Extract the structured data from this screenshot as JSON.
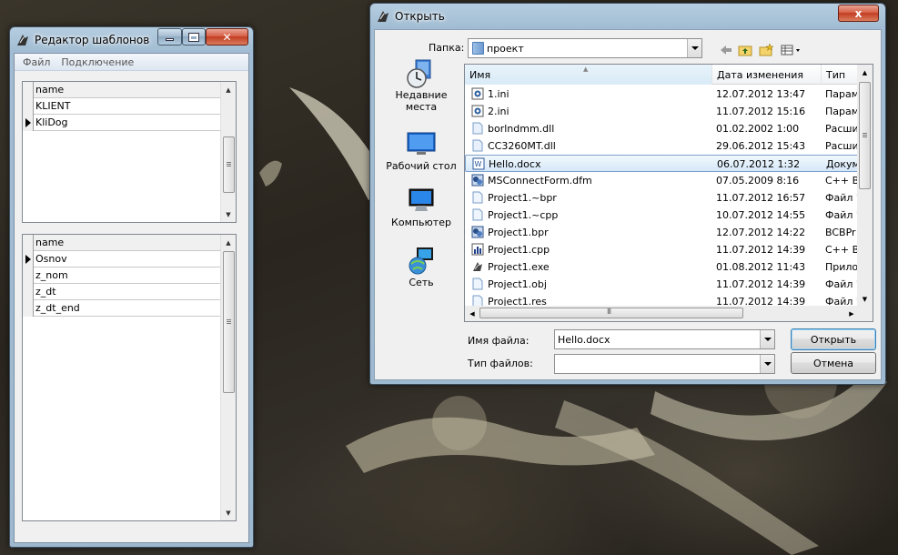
{
  "left_window": {
    "title": "Редактор шаблонов",
    "menu": [
      "Файл",
      "Подключение"
    ],
    "grid1": {
      "header": "name",
      "rows": [
        "KLIENT",
        "KliDog"
      ],
      "current_row": 1
    },
    "grid2": {
      "header": "name",
      "rows": [
        "Osnov",
        "z_nom",
        "z_dt",
        "z_dt_end"
      ],
      "current_row": 0
    }
  },
  "open_dialog": {
    "title": "Открыть",
    "folder_label": "Папка:",
    "folder_value": "проект",
    "places": [
      {
        "label": "Недавние места",
        "icon": "recent-places-icon"
      },
      {
        "label": "Рабочий стол",
        "icon": "desktop-icon"
      },
      {
        "label": "Компьютер",
        "icon": "computer-icon"
      },
      {
        "label": "Сеть",
        "icon": "network-icon"
      }
    ],
    "columns": [
      "Имя",
      "Дата изменения",
      "Тип"
    ],
    "files": [
      {
        "name": "1.ini",
        "date": "12.07.2012 13:47",
        "type": "Парам",
        "icon": "ini-file-icon"
      },
      {
        "name": "2.ini",
        "date": "11.07.2012 15:16",
        "type": "Парам",
        "icon": "ini-file-icon"
      },
      {
        "name": "borlndmm.dll",
        "date": "01.02.2002 1:00",
        "type": "Расши",
        "icon": "dll-file-icon"
      },
      {
        "name": "CC3260MT.dll",
        "date": "29.06.2012 15:43",
        "type": "Расши",
        "icon": "dll-file-icon"
      },
      {
        "name": "Hello.docx",
        "date": "06.07.2012 1:32",
        "type": "Докум",
        "icon": "docx-file-icon"
      },
      {
        "name": "MSConnectForm.dfm",
        "date": "07.05.2009 8:16",
        "type": "C++ Bu",
        "icon": "dfm-file-icon"
      },
      {
        "name": "Project1.~bpr",
        "date": "11.07.2012 16:57",
        "type": "Файл '",
        "icon": "generic-file-icon"
      },
      {
        "name": "Project1.~cpp",
        "date": "10.07.2012 14:55",
        "type": "Файл '",
        "icon": "generic-file-icon"
      },
      {
        "name": "Project1.bpr",
        "date": "12.07.2012 14:22",
        "type": "BCBPr",
        "icon": "bpr-file-icon"
      },
      {
        "name": "Project1.cpp",
        "date": "11.07.2012 14:39",
        "type": "C++ Bu",
        "icon": "cpp-file-icon"
      },
      {
        "name": "Project1.exe",
        "date": "01.08.2012 11:43",
        "type": "Прило",
        "icon": "exe-file-icon"
      },
      {
        "name": "Project1.obj",
        "date": "11.07.2012 14:39",
        "type": "Файл '",
        "icon": "generic-file-icon"
      },
      {
        "name": "Project1.res",
        "date": "11.07.2012 14:39",
        "type": "Файл '",
        "icon": "generic-file-icon"
      }
    ],
    "selected_index": 4,
    "filename_label": "Имя файла:",
    "filename_value": "Hello.docx",
    "filetype_label": "Тип файлов:",
    "filetype_value": "",
    "open_button": "Открыть",
    "cancel_button": "Отмена",
    "close_glyph": "x",
    "hscroll_marker": "III"
  },
  "colors": {
    "selection": "#d5e8f8",
    "close_button": "#c13d22",
    "window_frame": "#a2bdd3"
  }
}
